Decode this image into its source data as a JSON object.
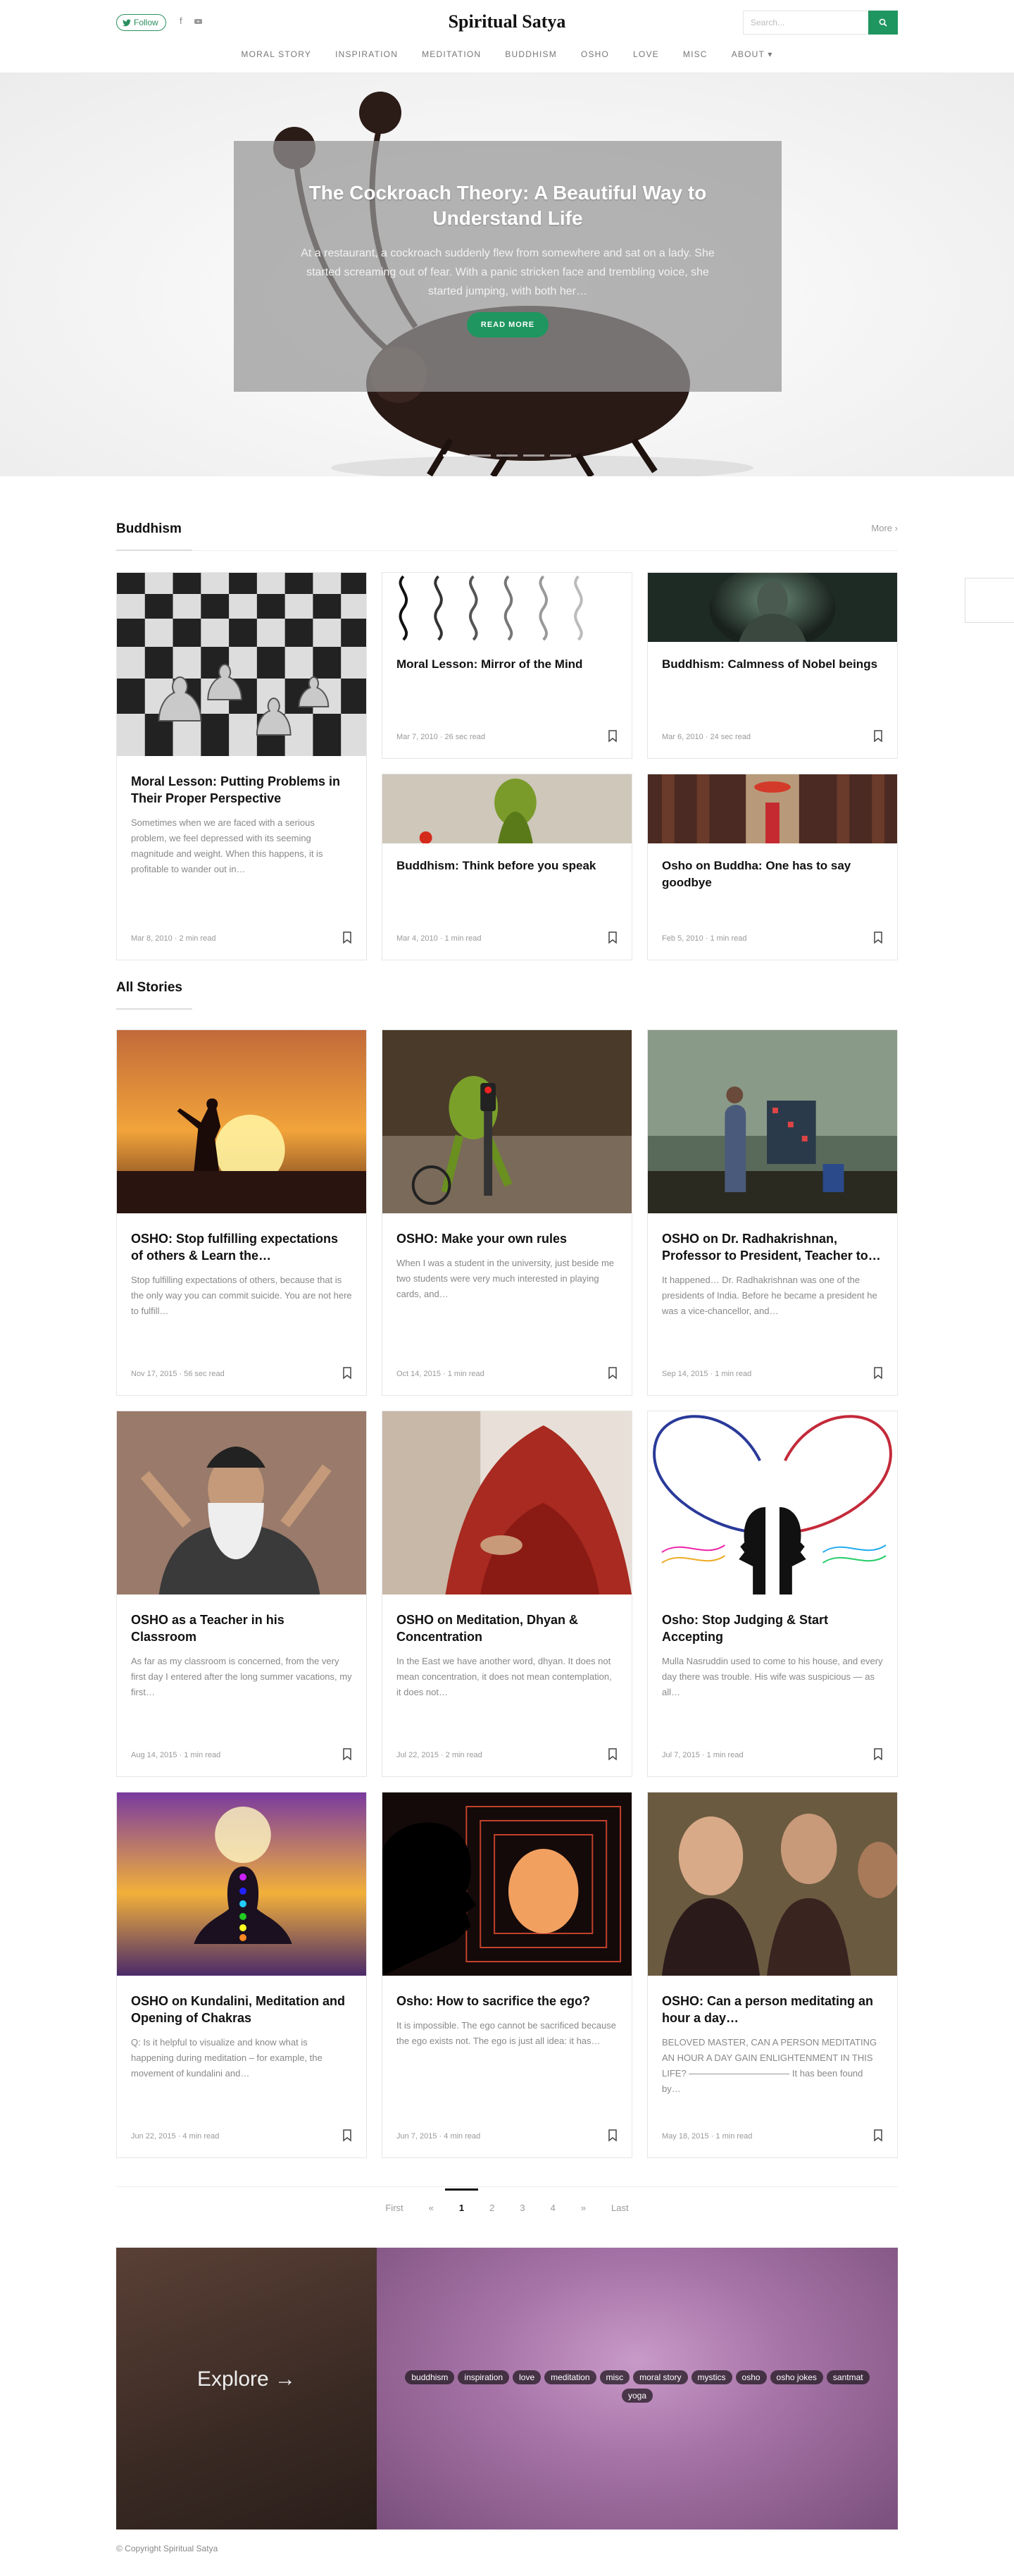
{
  "header": {
    "follow_label": "Follow",
    "brand": "Spiritual Satya",
    "search_placeholder": "Search...",
    "nav": [
      "MORAL STORY",
      "INSPIRATION",
      "MEDITATION",
      "BUDDHISM",
      "OSHO",
      "LOVE",
      "MISC",
      "ABOUT ▾"
    ]
  },
  "hero": {
    "title": "The Cockroach Theory: A Beautiful Way to Understand Life",
    "excerpt": "At a restaurant, a cockroach suddenly flew from somewhere and sat on a lady. She started screaming out of fear. With a panic stricken face and trembling voice, she started jumping, with both her…",
    "button": "READ MORE",
    "active_slide": 1,
    "slide_count": 5
  },
  "buddhism": {
    "title": "Buddhism",
    "more": "More",
    "featured": {
      "title": "Moral Lesson: Putting Problems in Their Proper Perspective",
      "excerpt": "Sometimes when we are faced with a serious problem, we feel depressed with its seeming magnitude and weight. When this happens, it is profitable to wander out in…",
      "meta": "Mar 8, 2010 · 2 min read"
    },
    "cards": [
      {
        "title": "Moral Lesson: Mirror of the Mind",
        "meta": "Mar 7, 2010 · 26 sec read"
      },
      {
        "title": "Buddhism: Calmness of Nobel beings",
        "meta": "Mar 6, 2010 · 24 sec read"
      },
      {
        "title": "Buddhism: Think before you speak",
        "meta": "Mar 4, 2010 · 1 min read"
      },
      {
        "title": "Osho on Buddha: One has to say goodbye",
        "meta": "Feb 5, 2010 · 1 min read"
      }
    ]
  },
  "all_stories": {
    "title": "All Stories",
    "cards": [
      {
        "title": "OSHO: Stop fulfilling expectations of others & Learn the…",
        "excerpt": "Stop fulfilling expectations of others, because that is the only way you can commit suicide. You are not here to fulfill…",
        "meta": "Nov 17, 2015 · 56 sec read"
      },
      {
        "title": "OSHO: Make your own rules",
        "excerpt": "When I was a student in the university, just beside me two students were very much interested in playing cards, and…",
        "meta": "Oct 14, 2015 · 1 min read"
      },
      {
        "title": "OSHO on Dr. Radhakrishnan, Professor to President, Teacher to…",
        "excerpt": "It happened… Dr. Radhakrishnan was one of the presidents of India. Before he became a president he was a vice-chancellor, and…",
        "meta": "Sep 14, 2015 · 1 min read"
      },
      {
        "title": "OSHO as a Teacher in his Classroom",
        "excerpt": "As far as my classroom is concerned, from the very first day I entered after the long summer vacations, my first…",
        "meta": "Aug 14, 2015 · 1 min read"
      },
      {
        "title": "OSHO on Meditation, Dhyan & Concentration",
        "excerpt": "In the East we have another word, dhyan. It does not mean concentration, it does not mean contemplation, it does not…",
        "meta": "Jul 22, 2015 · 2 min read"
      },
      {
        "title": "Osho: Stop Judging & Start Accepting",
        "excerpt": "Mulla Nasruddin used to come to his house, and every day there was trouble. His wife was suspicious — as all…",
        "meta": "Jul 7, 2015 · 1 min read"
      },
      {
        "title": "OSHO on Kundalini, Meditation and Opening of Chakras",
        "excerpt": "Q: Is it helpful to visualize and know what is happening during meditation – for example, the movement of kundalini and…",
        "meta": "Jun 22, 2015 · 4 min read"
      },
      {
        "title": "Osho: How to sacrifice the ego?",
        "excerpt": "It is impossible. The ego cannot be sacrificed because the ego exists not. The ego is just all idea: it has…",
        "meta": "Jun 7, 2015 · 4 min read"
      },
      {
        "title": "OSHO: Can a person meditating an hour a day…",
        "excerpt": "BELOVED MASTER, CAN A PERSON MEDITATING AN HOUR A DAY GAIN ENLIGHTENMENT IN THIS LIFE? ——————————— It has been found by…",
        "meta": "May 18, 2015 · 1 min read"
      }
    ]
  },
  "pagination": {
    "first": "First",
    "prev": "«",
    "pages": [
      "1",
      "2",
      "3",
      "4"
    ],
    "current": "1",
    "next": "»",
    "last": "Last"
  },
  "explore": {
    "title": "Explore →",
    "tags": [
      "buddhism",
      "inspiration",
      "love",
      "meditation",
      "misc",
      "moral story",
      "mystics",
      "osho",
      "osho jokes",
      "santmat",
      "yoga"
    ]
  },
  "footer": {
    "copyright": "© Copyright Spiritual Satya"
  },
  "colors": {
    "accent": "#1f9660",
    "text": "#111111",
    "muted": "#999999"
  }
}
